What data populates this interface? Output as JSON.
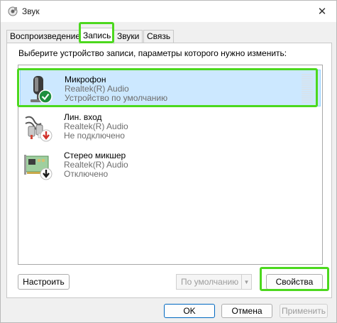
{
  "window": {
    "title": "Звук",
    "close_glyph": "✕"
  },
  "tabs": [
    {
      "label": "Воспроизведение",
      "active": false
    },
    {
      "label": "Запись",
      "active": true
    },
    {
      "label": "Звуки",
      "active": false
    },
    {
      "label": "Связь",
      "active": false
    }
  ],
  "prompt": "Выберите устройство записи, параметры которого нужно изменить:",
  "devices": [
    {
      "name": "Микрофон",
      "driver": "Realtek(R) Audio",
      "status": "Устройство по умолчанию",
      "icon": "microphone-icon",
      "badge": "check-badge-icon",
      "selected": true
    },
    {
      "name": "Лин. вход",
      "driver": "Realtek(R) Audio",
      "status": "Не подключено",
      "icon": "line-in-cable-icon",
      "badge": "red-down-arrow-badge-icon",
      "selected": false
    },
    {
      "name": "Стерео микшер",
      "driver": "Realtek(R) Audio",
      "status": "Отключено",
      "icon": "sound-card-icon",
      "badge": "black-down-arrow-badge-icon",
      "selected": false
    }
  ],
  "buttons": {
    "configure": "Настроить",
    "default_combo": "По умолчанию",
    "properties": "Свойства",
    "ok": "OK",
    "cancel": "Отмена",
    "apply": "Применить"
  },
  "colors": {
    "highlight": "#4cd81e",
    "selection": "#cce8ff",
    "accent": "#0067c0"
  }
}
